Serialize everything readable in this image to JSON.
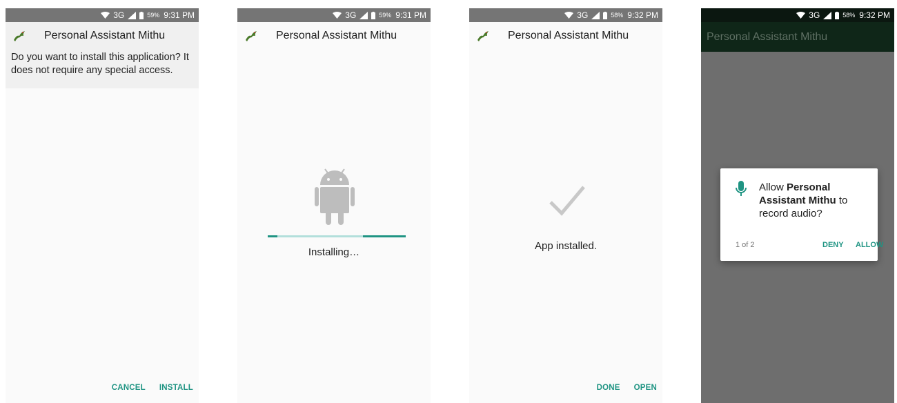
{
  "screens": [
    {
      "status": {
        "network": "3G",
        "battery_pct": "59%",
        "time": "9:31 PM"
      },
      "app_name": "Personal Assistant Mithu",
      "message": "Do you want to install this application? It does not require any special access.",
      "actions": {
        "cancel": "CANCEL",
        "install": "INSTALL"
      }
    },
    {
      "status": {
        "network": "3G",
        "battery_pct": "59%",
        "time": "9:31 PM"
      },
      "app_name": "Personal Assistant Mithu",
      "progress_text": "Installing…",
      "icon": "android-robot-icon"
    },
    {
      "status": {
        "network": "3G",
        "battery_pct": "58%",
        "time": "9:32 PM"
      },
      "app_name": "Personal Assistant Mithu",
      "result_text": "App installed.",
      "icon": "checkmark-icon",
      "actions": {
        "done": "DONE",
        "open": "OPEN"
      }
    },
    {
      "status": {
        "network": "3G",
        "battery_pct": "58%",
        "time": "9:32 PM"
      },
      "app_bar_title": "Personal Assistant Mithu",
      "dialog": {
        "prefix": "Allow ",
        "app_name": "Personal Assistant Mithu",
        "suffix": " to record audio?",
        "counter": "1 of 2",
        "deny": "DENY",
        "allow": "ALLOW",
        "icon": "microphone-icon"
      }
    }
  ],
  "colors": {
    "accent": "#1f9483",
    "statusbar": "#757575",
    "dark_statusbar": "#0b1710",
    "app_bar": "#0f2618",
    "scrim": "#6e6e6e",
    "progress_track": "#b2dfdb"
  }
}
